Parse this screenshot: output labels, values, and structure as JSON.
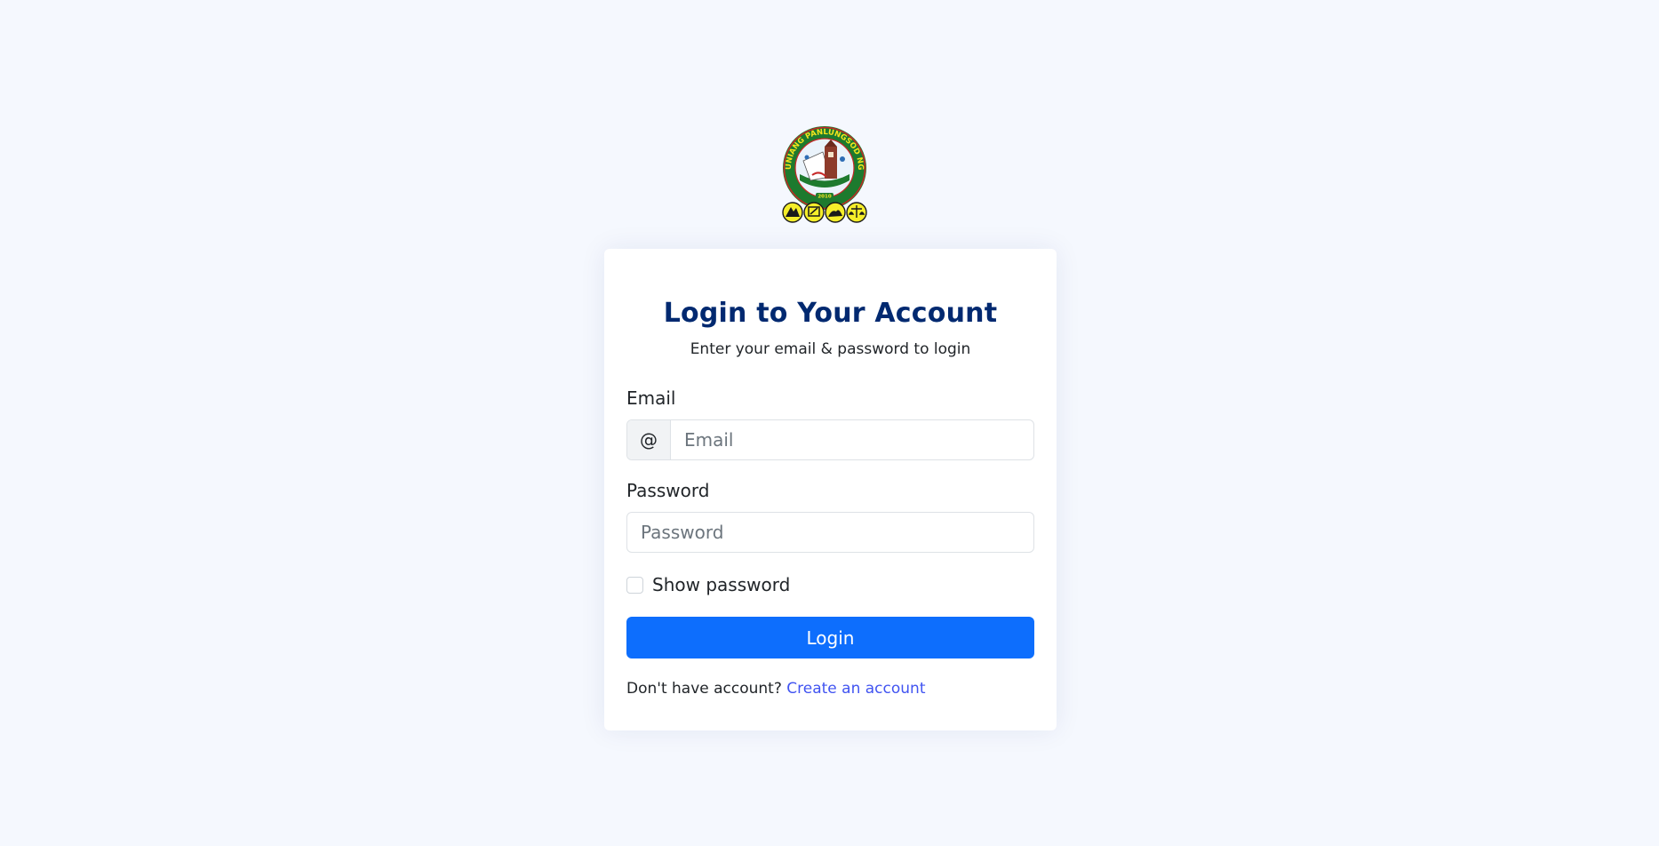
{
  "logo": {
    "seal_text": "SANGGUNIANG PANLUNGSOD NG BIÑAN",
    "seal_year": "2010",
    "icon": "city-seal-logo"
  },
  "card": {
    "title": "Login to Your Account",
    "subtitle": "Enter your email & password to login"
  },
  "email": {
    "label": "Email",
    "addon": "@",
    "placeholder": "Email",
    "value": ""
  },
  "password": {
    "label": "Password",
    "placeholder": "Password",
    "value": ""
  },
  "show_password": {
    "label": "Show password",
    "checked": false
  },
  "login_button": {
    "label": "Login"
  },
  "signup": {
    "prompt": "Don't have account?",
    "link_label": "Create an account"
  },
  "colors": {
    "page_bg": "#f5f8fe",
    "title": "#012970",
    "primary": "#0d6efd",
    "link": "#4154f1"
  }
}
